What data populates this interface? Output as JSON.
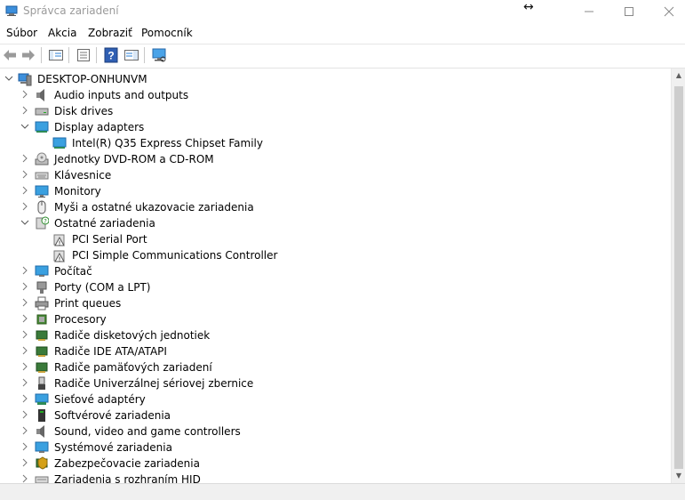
{
  "window": {
    "title": "Správca zariadení"
  },
  "menu": {
    "items": [
      "Súbor",
      "Akcia",
      "Zobraziť",
      "Pomocník"
    ]
  },
  "toolbar": {
    "buttons": [
      "back-icon",
      "forward-icon",
      "show-hide-console-tree-icon",
      "properties-icon",
      "help-icon",
      "action-pane-icon",
      "scan-hardware-icon"
    ]
  },
  "tree": {
    "root": "DESKTOP-ONHUNVM",
    "items": [
      {
        "label": "Audio inputs and outputs",
        "icon": "speaker-icon",
        "expanded": false,
        "level": 1
      },
      {
        "label": "Disk drives",
        "icon": "disk-drive-icon",
        "expanded": false,
        "level": 1
      },
      {
        "label": "Display adapters",
        "icon": "display-adapter-icon",
        "expanded": true,
        "level": 1
      },
      {
        "label": "Intel(R) Q35 Express Chipset Family",
        "icon": "display-adapter-icon",
        "level": 2
      },
      {
        "label": "Jednotky DVD-ROM a CD-ROM",
        "icon": "dvd-drive-icon",
        "expanded": false,
        "level": 1
      },
      {
        "label": "Klávesnice",
        "icon": "keyboard-icon",
        "expanded": false,
        "level": 1
      },
      {
        "label": "Monitory",
        "icon": "monitor-icon",
        "expanded": false,
        "level": 1
      },
      {
        "label": "Myši a ostatné ukazovacie zariadenia",
        "icon": "mouse-icon",
        "expanded": false,
        "level": 1
      },
      {
        "label": "Ostatné zariadenia",
        "icon": "unknown-device-icon",
        "expanded": true,
        "level": 1
      },
      {
        "label": "PCI Serial Port",
        "icon": "warning-device-icon",
        "level": 2
      },
      {
        "label": "PCI Simple Communications Controller",
        "icon": "warning-device-icon",
        "level": 2
      },
      {
        "label": "Počítač",
        "icon": "computer-icon",
        "expanded": false,
        "level": 1
      },
      {
        "label": "Porty (COM a LPT)",
        "icon": "port-icon",
        "expanded": false,
        "level": 1
      },
      {
        "label": "Print queues",
        "icon": "printer-icon",
        "expanded": false,
        "level": 1
      },
      {
        "label": "Procesory",
        "icon": "processor-icon",
        "expanded": false,
        "level": 1
      },
      {
        "label": "Radiče disketových jednotiek",
        "icon": "floppy-controller-icon",
        "expanded": false,
        "level": 1
      },
      {
        "label": "Radiče IDE ATA/ATAPI",
        "icon": "ide-controller-icon",
        "expanded": false,
        "level": 1
      },
      {
        "label": "Radiče pamäťových zariadení",
        "icon": "storage-controller-icon",
        "expanded": false,
        "level": 1
      },
      {
        "label": "Radiče Univerzálnej sériovej zbernice",
        "icon": "usb-icon",
        "expanded": false,
        "level": 1
      },
      {
        "label": "Sieťové adaptéry",
        "icon": "network-adapter-icon",
        "expanded": false,
        "level": 1
      },
      {
        "label": "Softvérové zariadenia",
        "icon": "software-device-icon",
        "expanded": false,
        "level": 1
      },
      {
        "label": "Sound, video and game controllers",
        "icon": "sound-icon",
        "expanded": false,
        "level": 1
      },
      {
        "label": "Systémové zariadenia",
        "icon": "system-device-icon",
        "expanded": false,
        "level": 1
      },
      {
        "label": "Zabezpečovacie zariadenia",
        "icon": "security-device-icon",
        "expanded": false,
        "level": 1
      },
      {
        "label": "Zariadenia s rozhraním HID",
        "icon": "hid-icon",
        "expanded": false,
        "level": 1
      }
    ]
  },
  "colors": {
    "selection": "#cce8ff",
    "icon_blue": "#2a7fd4",
    "title_gray": "#9a9a9a"
  }
}
